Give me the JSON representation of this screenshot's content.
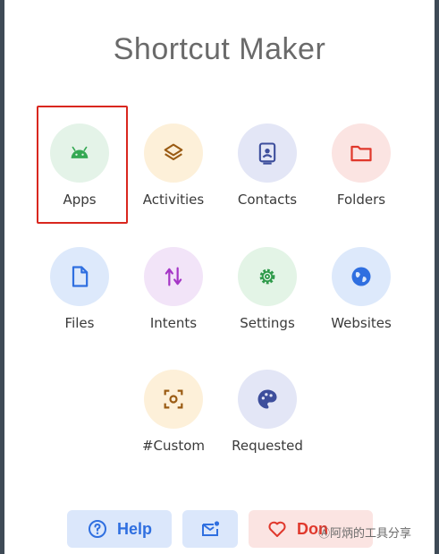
{
  "header": {
    "title": "Shortcut Maker"
  },
  "tiles": [
    {
      "label": "Apps",
      "bg": "#e4f3e8",
      "fg": "#34a853",
      "icon": "android-icon"
    },
    {
      "label": "Activities",
      "bg": "#fdf0d9",
      "fg": "#9a5b13",
      "icon": "layers-icon"
    },
    {
      "label": "Contacts",
      "bg": "#e3e6f6",
      "fg": "#3d4e9c",
      "icon": "contact-icon"
    },
    {
      "label": "Folders",
      "bg": "#fbe4e2",
      "fg": "#e0382c",
      "icon": "folder-icon"
    },
    {
      "label": "Files",
      "bg": "#dde9fb",
      "fg": "#2f6fe0",
      "icon": "file-icon"
    },
    {
      "label": "Intents",
      "bg": "#f2e4f8",
      "fg": "#a536c6",
      "icon": "swap-arrows-icon"
    },
    {
      "label": "Settings",
      "bg": "#e3f4e6",
      "fg": "#2e9a4a",
      "icon": "gear-icon"
    },
    {
      "label": "Websites",
      "bg": "#dde9fb",
      "fg": "#2f6fe0",
      "icon": "globe-icon"
    },
    {
      "label": "#Custom",
      "bg": "#fdf0d9",
      "fg": "#9a5b13",
      "icon": "scan-frame-icon"
    },
    {
      "label": "Requested",
      "bg": "#e3e6f6",
      "fg": "#3d4e9c",
      "icon": "palette-icon"
    }
  ],
  "selected_tile": "Apps",
  "footer": {
    "help_label": "Help",
    "donate_label": "Don",
    "help_color": "#2f6fe0",
    "donate_color": "#e0382c"
  },
  "watermark": {
    "text": "Ⓐ阿炳的工具分享"
  }
}
